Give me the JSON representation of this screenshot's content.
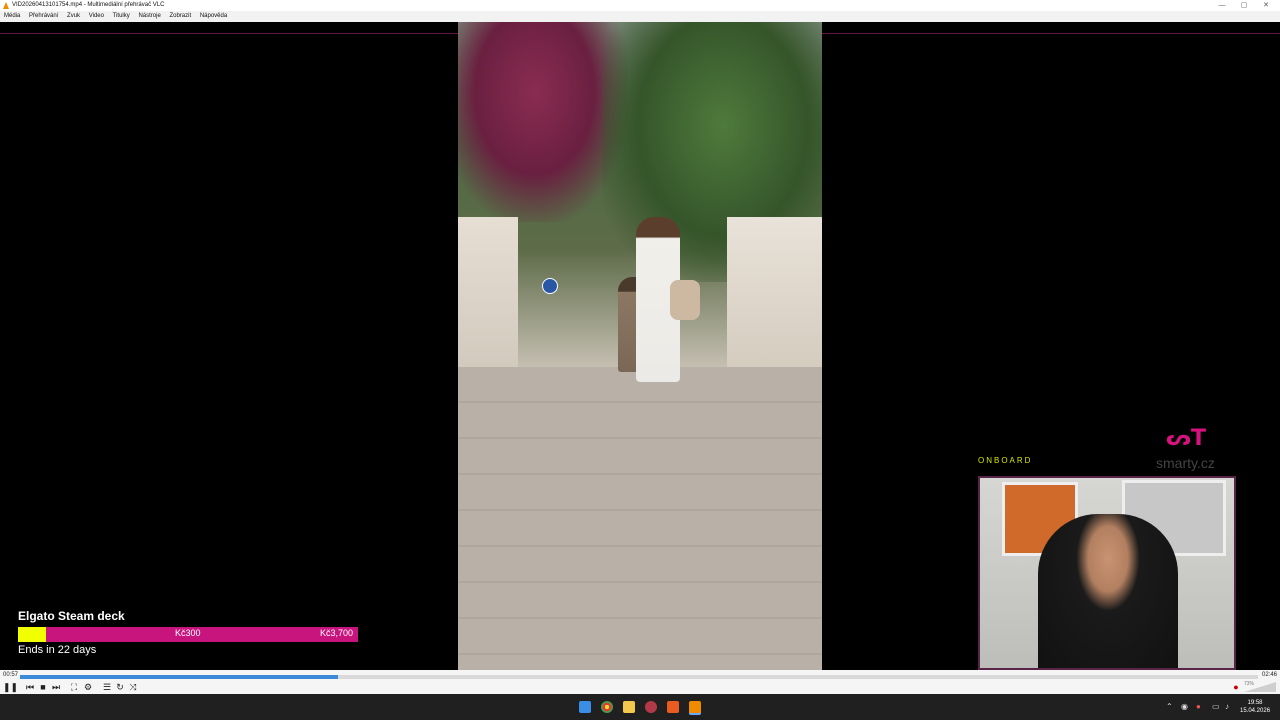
{
  "window": {
    "title": "VID20260413101754.mp4 - Multimediální přehrávač VLC",
    "controls": {
      "minimize": "—",
      "maximize": "▢",
      "close": "✕"
    }
  },
  "menubar": [
    "Média",
    "Přehrávání",
    "Zvuk",
    "Video",
    "Titulky",
    "Nástroje",
    "Zobrazit",
    "Nápověda"
  ],
  "overlay": {
    "donation": {
      "item": "Elgato Steam deck",
      "current": "Kč300",
      "goal": "Kč3,700",
      "progress_fraction": 0.081,
      "ends_text": "Ends in 22 days"
    },
    "cam_label": "ONBOARD",
    "brand_logo": "ᔕT",
    "brand_text": "smarty.cz"
  },
  "player": {
    "elapsed": "00:57",
    "total": "02:46",
    "progress_fraction": 0.257,
    "volume": "73%"
  },
  "taskbar": {
    "tray_chevron": "⌃",
    "time": "19:58",
    "date": "15.04.2026"
  },
  "colors": {
    "accent_pink": "#c8157e",
    "donation_fill": "#f2ff00",
    "timeline_played": "#3b8ad9"
  }
}
